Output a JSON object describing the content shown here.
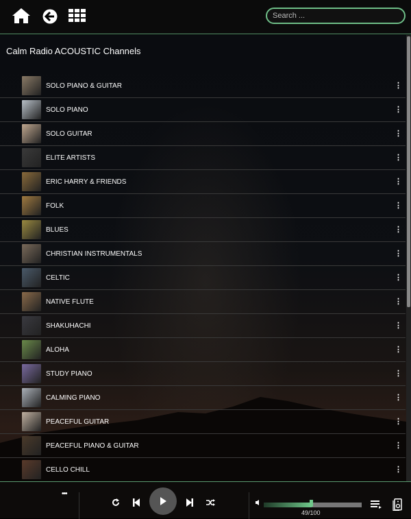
{
  "header": {
    "search_placeholder": "Search ..."
  },
  "main": {
    "title": "Calm Radio ACOUSTIC Channels",
    "channels": [
      {
        "label": "SOLO PIANO & GUITAR",
        "color": "#8a7a66"
      },
      {
        "label": "SOLO PIANO",
        "color": "#b8c0c8"
      },
      {
        "label": "SOLO GUITAR",
        "color": "#c0a890"
      },
      {
        "label": "ELITE ARTISTS",
        "color": "#3a3a3a"
      },
      {
        "label": "ERIC HARRY & FRIENDS",
        "color": "#8a6a3a"
      },
      {
        "label": "FOLK",
        "color": "#a07a40"
      },
      {
        "label": "BLUES",
        "color": "#9a8a40"
      },
      {
        "label": "CHRISTIAN INSTRUMENTALS",
        "color": "#7a6a5a"
      },
      {
        "label": "CELTIC",
        "color": "#4a5a6a"
      },
      {
        "label": "NATIVE FLUTE",
        "color": "#8a6a4a"
      },
      {
        "label": "SHAKUHACHI",
        "color": "#3a3a40"
      },
      {
        "label": "ALOHA",
        "color": "#6a8a4a"
      },
      {
        "label": "STUDY PIANO",
        "color": "#7a6aa0"
      },
      {
        "label": "CALMING PIANO",
        "color": "#aab0b8"
      },
      {
        "label": "PEACEFUL GUITAR",
        "color": "#c0b0a0"
      },
      {
        "label": "PEACEFUL PIANO & GUITAR",
        "color": "#4a3a2a"
      },
      {
        "label": "CELLO CHILL",
        "color": "#5a3a2a"
      }
    ]
  },
  "player": {
    "volume": 49,
    "volume_max": 100,
    "volume_text": "49/100",
    "accent": "#6fc88a"
  }
}
